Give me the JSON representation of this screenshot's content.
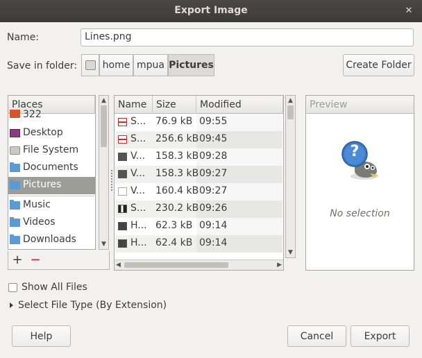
{
  "window": {
    "title": "Export Image",
    "close_glyph": "✕"
  },
  "name": {
    "label": "Name:",
    "value": "Lines.png"
  },
  "folder": {
    "label": "Save in folder:",
    "breadcrumbs": [
      "home",
      "mpua",
      "Pictures"
    ],
    "create_folder_label": "Create Folder"
  },
  "places": {
    "header": "Places",
    "items": [
      {
        "label": "322",
        "icon": "drive-icon"
      },
      {
        "label": "Desktop",
        "icon": "desktop-icon"
      },
      {
        "label": "File System",
        "icon": "disk-icon"
      },
      {
        "label": "Documents",
        "icon": "folder-icon"
      },
      {
        "label": "Pictures",
        "icon": "folder-icon"
      },
      {
        "label": "Music",
        "icon": "folder-icon"
      },
      {
        "label": "Videos",
        "icon": "folder-icon"
      },
      {
        "label": "Downloads",
        "icon": "folder-icon"
      }
    ],
    "add_glyph": "+",
    "remove_glyph": "−"
  },
  "files": {
    "columns": [
      "Name",
      "Size",
      "Modified"
    ],
    "rows": [
      {
        "name": "S...",
        "size": "76.9 kB",
        "modified": "09:55"
      },
      {
        "name": "S...",
        "size": "256.6 kB",
        "modified": "09:45"
      },
      {
        "name": "V...",
        "size": "158.3 kB",
        "modified": "09:28"
      },
      {
        "name": "V...",
        "size": "158.3 kB",
        "modified": "09:27"
      },
      {
        "name": "V...",
        "size": "160.4 kB",
        "modified": "09:27"
      },
      {
        "name": "S...",
        "size": "230.2 kB",
        "modified": "09:26"
      },
      {
        "name": "H...",
        "size": "62.3 kB",
        "modified": "09:14"
      },
      {
        "name": "H...",
        "size": "62.4 kB",
        "modified": "09:14"
      }
    ]
  },
  "preview": {
    "header": "Preview",
    "empty_text": "No selection"
  },
  "options": {
    "show_all_files": "Show All Files",
    "select_file_type": "Select File Type (By Extension)"
  },
  "buttons": {
    "help": "Help",
    "cancel": "Cancel",
    "export": "Export"
  }
}
